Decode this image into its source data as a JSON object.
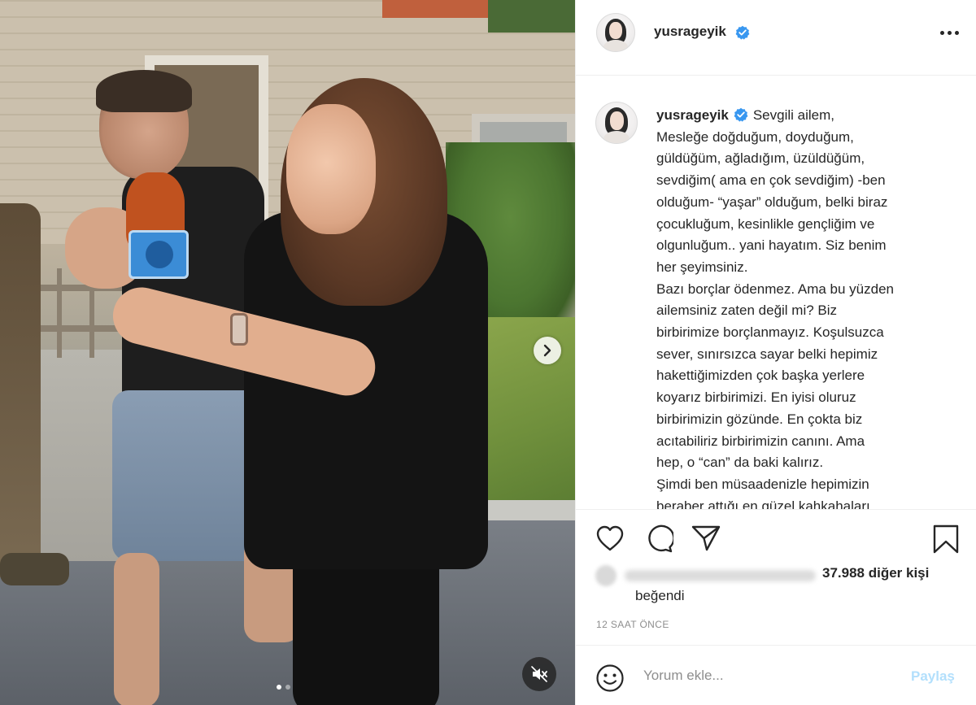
{
  "post": {
    "username": "yusrageyik",
    "verified": true,
    "media": {
      "slide_count": 2,
      "active_slide": 1,
      "muted": true
    },
    "caption_lines": [
      "Sevgili ailem,",
      "Mesleğe doğduğum, doyduğum,",
      "güldüğüm, ağladığım, üzüldüğüm,",
      "sevdiğim( ama en çok sevdiğim) -ben",
      "olduğum- “yaşar” olduğum, belki biraz",
      "çocukluğum, kesinlikle gençliğim ve",
      "olgunluğum.. yani hayatım. Siz benim",
      "her şeyimsiniz.",
      "Bazı borçlar ödenmez. Ama bu yüzden",
      "ailemsiniz zaten değil mi? Biz",
      "birbirimize borçlanmayız. Koşulsuzca",
      "sever, sınırsızca sayar belki hepimiz",
      "hakettiğimizden çok başka yerlere",
      "koyarız birbirimizi. En iyisi oluruz",
      "birbirimizin gözünde. En çokta biz",
      "acıtabiliriz birbirimizin canını. Ama",
      "hep, o “can” da baki kalırız.",
      "Şimdi ben müsaadenizle hepimizin",
      "beraber attığı en güzel kahkahaları"
    ],
    "likes": {
      "count_text": "37.988 diğer kişi",
      "suffix": "beğendi"
    },
    "timestamp": "12 SAAT ÖNCE"
  },
  "comment_box": {
    "placeholder": "Yorum ekle...",
    "post_label": "Paylaş"
  },
  "icons": {
    "verified": "verified-badge-icon",
    "more": "more-options-icon",
    "like": "heart-icon",
    "comment": "comment-bubble-icon",
    "share": "paper-plane-icon",
    "save": "bookmark-icon",
    "next": "chevron-right-icon",
    "mute": "speaker-muted-icon",
    "emoji": "smiley-icon"
  },
  "colors": {
    "verified_blue": "#3897f0",
    "text_primary": "#262626",
    "text_secondary": "#8e8e8e",
    "post_button_disabled": "#b2dffc",
    "divider": "#efefef"
  }
}
